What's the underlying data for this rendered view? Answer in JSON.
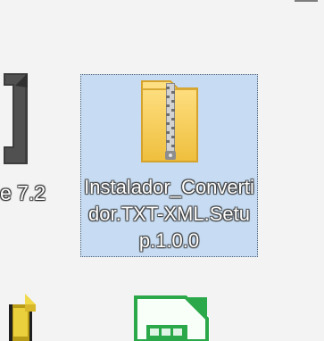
{
  "desktop": {
    "items": [
      {
        "label": "e 7.2",
        "icon": "document-icon"
      },
      {
        "label": "Instalador_Convertidor.TXT-XML.Setup.1.0.0",
        "icon": "zip-folder-icon",
        "selected": true
      },
      {
        "icon": "app-icon"
      },
      {
        "icon": "spreadsheet-icon"
      }
    ]
  },
  "colors": {
    "background": "#f3f3f3",
    "selection_fill": "#c7dcf2",
    "selection_border": "#4e5f73",
    "zip_yellow": "#f4c84d",
    "spreadsheet_green": "#2ba84a"
  }
}
